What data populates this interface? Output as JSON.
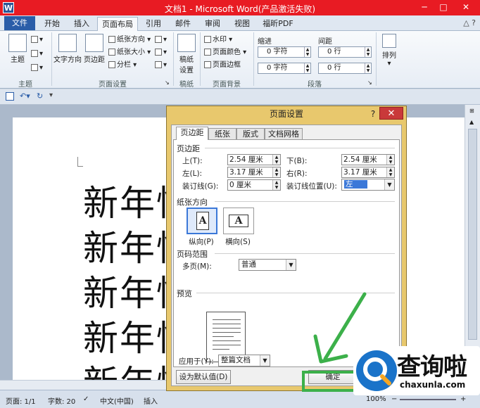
{
  "window": {
    "title": "文档1 - Microsoft Word(产品激活失败)"
  },
  "tabs": [
    "文件",
    "开始",
    "插入",
    "页面布局",
    "引用",
    "邮件",
    "审阅",
    "视图",
    "福昕PDF"
  ],
  "ribbon": {
    "groups": {
      "theme": "主题",
      "page_setup": "页面设置",
      "draft": "稿纸",
      "page_bg": "页面背景",
      "paragraph": "段落"
    },
    "theme_btn": "主题",
    "text_dir": "文字方向",
    "margins": "页边距",
    "orientation": "纸张方向",
    "size": "纸张大小",
    "columns": "分栏",
    "draft_btn_1": "稿纸",
    "draft_btn_2": "设置",
    "watermark": "水印",
    "page_color": "页面颜色",
    "page_border": "页面边框",
    "indent_label": "缩进",
    "spacing_label": "间距",
    "indent_left": "0 字符",
    "indent_right": "0 字符",
    "spacing_before": "0 行",
    "spacing_after": "0 行",
    "arrange": "排列"
  },
  "document": {
    "line_text": "新年快"
  },
  "status": {
    "page": "页面: 1/1",
    "words": "字数: 20",
    "lang": "中文(中国)",
    "insert": "插入",
    "zoom": "100%"
  },
  "dialog": {
    "title": "页面设置",
    "help": "?",
    "close": "✕",
    "tabs": [
      "页边距",
      "纸张",
      "版式",
      "文档网格"
    ],
    "margins_section": "页边距",
    "top_label": "上(T):",
    "top_value": "2.54 厘米",
    "bottom_label": "下(B):",
    "bottom_value": "2.54 厘米",
    "left_label": "左(L):",
    "left_value": "3.17 厘米",
    "right_label": "右(R):",
    "right_value": "3.17 厘米",
    "gutter_label": "装订线(G):",
    "gutter_value": "0 厘米",
    "gutter_pos_label": "装订线位置(U):",
    "gutter_pos_value": "左",
    "orientation_section": "纸张方向",
    "portrait": "纵向(P)",
    "landscape": "横向(S)",
    "pages_section": "页码范围",
    "multi_label": "多页(M):",
    "multi_value": "普通",
    "preview_section": "预览",
    "apply_label": "应用于(Y):",
    "apply_value": "整篇文档",
    "default_btn": "设为默认值(D)",
    "ok_btn": "确定"
  },
  "watermark": {
    "brand": "查询啦",
    "url": "chaxunla.com"
  },
  "colors": {
    "title_bar": "#e81b23",
    "file_tab": "#2a5da8",
    "highlight": "#3cb04a",
    "dialog_frame": "#e8c86d"
  }
}
